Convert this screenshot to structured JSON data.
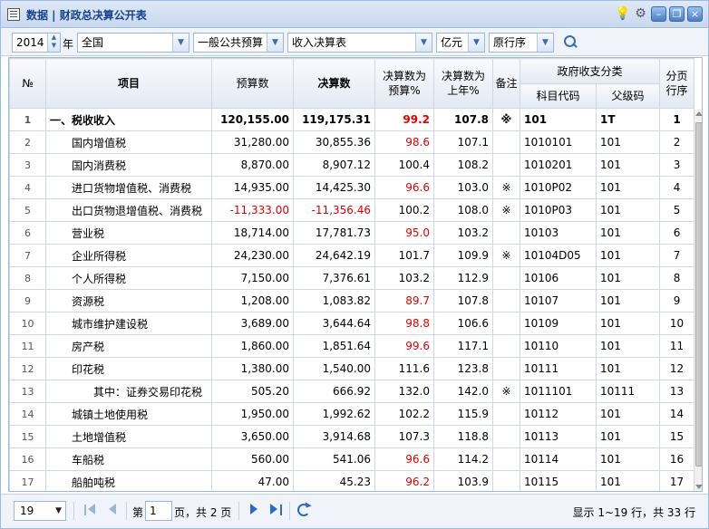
{
  "window": {
    "title": "数据 | 财政总决算公开表"
  },
  "toolbar": {
    "year": "2014",
    "year_suffix": "年",
    "region": "全国",
    "budget_type": "一般公共预算",
    "table_type": "收入决算表",
    "unit": "亿元",
    "order": "原行序"
  },
  "grid": {
    "headers": {
      "rownum": "№",
      "item": "项目",
      "budget": "预算数",
      "final": "决算数",
      "pct_budget_1": "决算数为",
      "pct_budget_2": "预算%",
      "pct_last_1": "决算数为",
      "pct_last_2": "上年%",
      "note": "备注",
      "gov_class": "政府收支分类",
      "subject_code": "科目代码",
      "parent_code": "父级码",
      "page_order_1": "分页",
      "page_order_2": "行序"
    },
    "rows": [
      {
        "n": "1",
        "item": "一、税收收入",
        "budget": "120,155.00",
        "final": "119,175.31",
        "pb": "99.2",
        "pl": "107.8",
        "note": "※",
        "code": "101",
        "parent": "1T",
        "order": "1",
        "level": 0,
        "bold": true,
        "pb_red": true,
        "neg": false
      },
      {
        "n": "2",
        "item": "国内增值税",
        "budget": "31,280.00",
        "final": "30,855.36",
        "pb": "98.6",
        "pl": "107.1",
        "note": "",
        "code": "1010101",
        "parent": "101",
        "order": "2",
        "level": 1,
        "pb_red": true,
        "neg": false
      },
      {
        "n": "3",
        "item": "国内消费税",
        "budget": "8,870.00",
        "final": "8,907.12",
        "pb": "100.4",
        "pl": "108.2",
        "note": "",
        "code": "1010201",
        "parent": "101",
        "order": "3",
        "level": 1,
        "pb_red": false,
        "neg": false
      },
      {
        "n": "4",
        "item": "进口货物增值税、消费税",
        "budget": "14,935.00",
        "final": "14,425.30",
        "pb": "96.6",
        "pl": "103.0",
        "note": "※",
        "code": "1010P02",
        "parent": "101",
        "order": "4",
        "level": 1,
        "pb_red": true,
        "neg": false
      },
      {
        "n": "5",
        "item": "出口货物退增值税、消费税",
        "budget": "-11,333.00",
        "final": "-11,356.46",
        "pb": "100.2",
        "pl": "108.0",
        "note": "※",
        "code": "1010P03",
        "parent": "101",
        "order": "5",
        "level": 1,
        "pb_red": false,
        "neg": true
      },
      {
        "n": "6",
        "item": "营业税",
        "budget": "18,714.00",
        "final": "17,781.73",
        "pb": "95.0",
        "pl": "103.2",
        "note": "",
        "code": "10103",
        "parent": "101",
        "order": "6",
        "level": 1,
        "pb_red": true,
        "neg": false
      },
      {
        "n": "7",
        "item": "企业所得税",
        "budget": "24,230.00",
        "final": "24,642.19",
        "pb": "101.7",
        "pl": "109.9",
        "note": "※",
        "code": "10104D05",
        "parent": "101",
        "order": "7",
        "level": 1,
        "pb_red": false,
        "neg": false
      },
      {
        "n": "8",
        "item": "个人所得税",
        "budget": "7,150.00",
        "final": "7,376.61",
        "pb": "103.2",
        "pl": "112.9",
        "note": "",
        "code": "10106",
        "parent": "101",
        "order": "8",
        "level": 1,
        "pb_red": false,
        "neg": false
      },
      {
        "n": "9",
        "item": "资源税",
        "budget": "1,208.00",
        "final": "1,083.82",
        "pb": "89.7",
        "pl": "107.8",
        "note": "",
        "code": "10107",
        "parent": "101",
        "order": "9",
        "level": 1,
        "pb_red": true,
        "neg": false
      },
      {
        "n": "10",
        "item": "城市维护建设税",
        "budget": "3,689.00",
        "final": "3,644.64",
        "pb": "98.8",
        "pl": "106.6",
        "note": "",
        "code": "10109",
        "parent": "101",
        "order": "10",
        "level": 1,
        "pb_red": true,
        "neg": false
      },
      {
        "n": "11",
        "item": "房产税",
        "budget": "1,860.00",
        "final": "1,851.64",
        "pb": "99.6",
        "pl": "117.1",
        "note": "",
        "code": "10110",
        "parent": "101",
        "order": "11",
        "level": 1,
        "pb_red": true,
        "neg": false
      },
      {
        "n": "12",
        "item": "印花税",
        "budget": "1,380.00",
        "final": "1,540.00",
        "pb": "111.6",
        "pl": "123.8",
        "note": "",
        "code": "10111",
        "parent": "101",
        "order": "12",
        "level": 1,
        "pb_red": false,
        "neg": false
      },
      {
        "n": "13",
        "item": "其中：证券交易印花税",
        "budget": "505.20",
        "final": "666.92",
        "pb": "132.0",
        "pl": "142.0",
        "note": "※",
        "code": "1011101",
        "parent": "10111",
        "order": "13",
        "level": 2,
        "pb_red": false,
        "neg": false
      },
      {
        "n": "14",
        "item": "城镇土地使用税",
        "budget": "1,950.00",
        "final": "1,992.62",
        "pb": "102.2",
        "pl": "115.9",
        "note": "",
        "code": "10112",
        "parent": "101",
        "order": "14",
        "level": 1,
        "pb_red": false,
        "neg": false
      },
      {
        "n": "15",
        "item": "土地增值税",
        "budget": "3,650.00",
        "final": "3,914.68",
        "pb": "107.3",
        "pl": "118.8",
        "note": "",
        "code": "10113",
        "parent": "101",
        "order": "15",
        "level": 1,
        "pb_red": false,
        "neg": false
      },
      {
        "n": "16",
        "item": "车船税",
        "budget": "560.00",
        "final": "541.06",
        "pb": "96.6",
        "pl": "114.2",
        "note": "",
        "code": "10114",
        "parent": "101",
        "order": "16",
        "level": 1,
        "pb_red": true,
        "neg": false
      },
      {
        "n": "17",
        "item": "船舶吨税",
        "budget": "47.00",
        "final": "45.23",
        "pb": "96.2",
        "pl": "103.9",
        "note": "",
        "code": "10115",
        "parent": "101",
        "order": "17",
        "level": 1,
        "pb_red": true,
        "neg": false
      }
    ]
  },
  "pager": {
    "page_size": "19",
    "page_label_pre": "第",
    "page_current": "1",
    "page_label_post": "页，共 2 页",
    "info": "显示 1~19 行，共 33 行"
  }
}
